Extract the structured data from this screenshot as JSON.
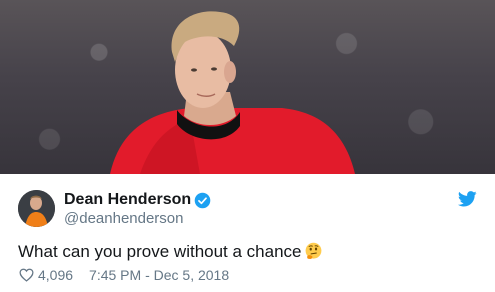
{
  "tweet": {
    "display_name": "Dean Henderson",
    "handle": "@deanhenderson",
    "text": "What can you prove without a chance",
    "likes": "4,096",
    "timestamp": "7:45 PM - Dec 5, 2018"
  },
  "icons": {
    "verified": "verified-badge-icon",
    "bird": "twitter-bird-icon",
    "heart": "heart-icon",
    "emoji": "thinking-face-icon"
  },
  "colors": {
    "twitter_blue": "#1da1f2",
    "name": "#14171a",
    "secondary": "#657786",
    "jersey_red": "#e21b2b"
  }
}
